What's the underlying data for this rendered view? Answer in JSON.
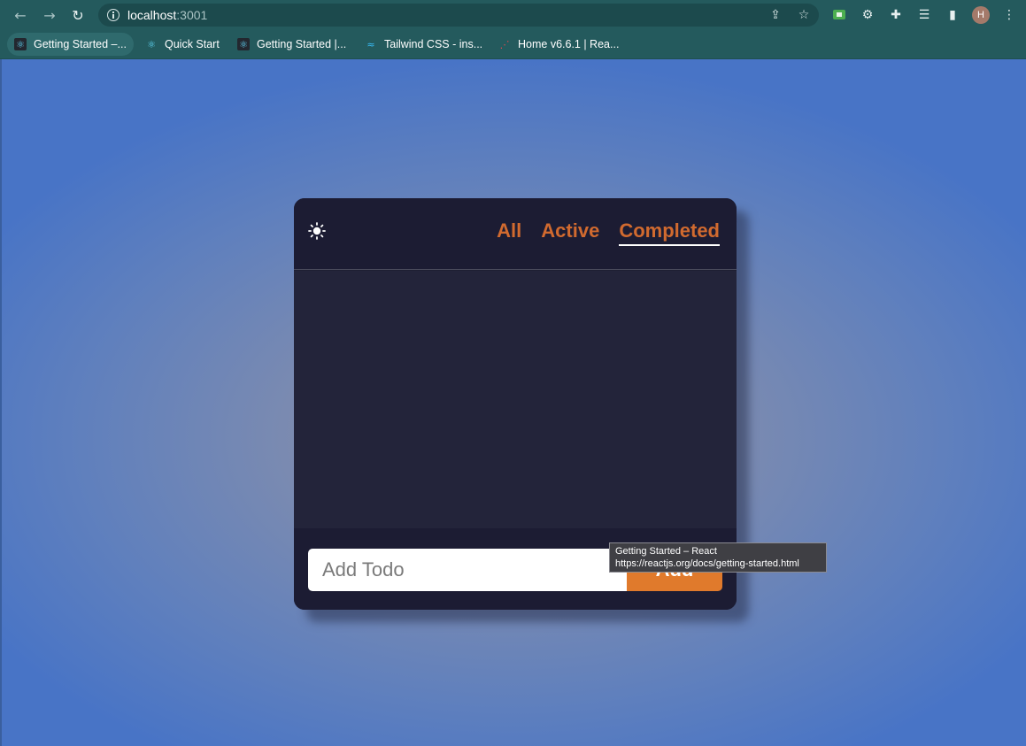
{
  "browser": {
    "url_host": "localhost",
    "url_port": ":3001",
    "avatar_initial": "H",
    "bookmarks": [
      {
        "label": "Getting Started –..."
      },
      {
        "label": "Quick Start"
      },
      {
        "label": "Getting Started |..."
      },
      {
        "label": "Tailwind CSS - ins..."
      },
      {
        "label": "Home v6.6.1 | Rea..."
      }
    ]
  },
  "app": {
    "tabs": [
      {
        "label": "All"
      },
      {
        "label": "Active"
      },
      {
        "label": "Completed"
      }
    ],
    "selected_tab": "Completed",
    "input_placeholder": "Add Todo",
    "add_button_label": "Add",
    "colors": {
      "accent": "#e07a2c",
      "tab_text": "#d16a2f",
      "card_bg": "#1e1f33"
    }
  },
  "tooltip": {
    "title": "Getting Started – React",
    "url": "https://reactjs.org/docs/getting-started.html"
  }
}
